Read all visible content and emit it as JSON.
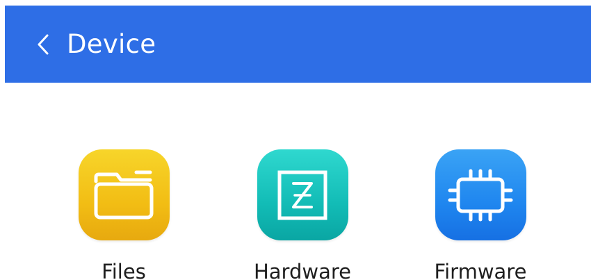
{
  "header": {
    "title": "Device",
    "back_icon": "chevron-left-icon",
    "background_color": "#2e6ee6"
  },
  "tiles": [
    {
      "label": "Files",
      "icon": "folder-icon",
      "color": "#f2bd14"
    },
    {
      "label": "Hardware",
      "icon": "hardware-z-icon",
      "color": "#12bcb6"
    },
    {
      "label": "Firmware",
      "icon": "chip-icon",
      "color": "#1f86ef"
    }
  ]
}
